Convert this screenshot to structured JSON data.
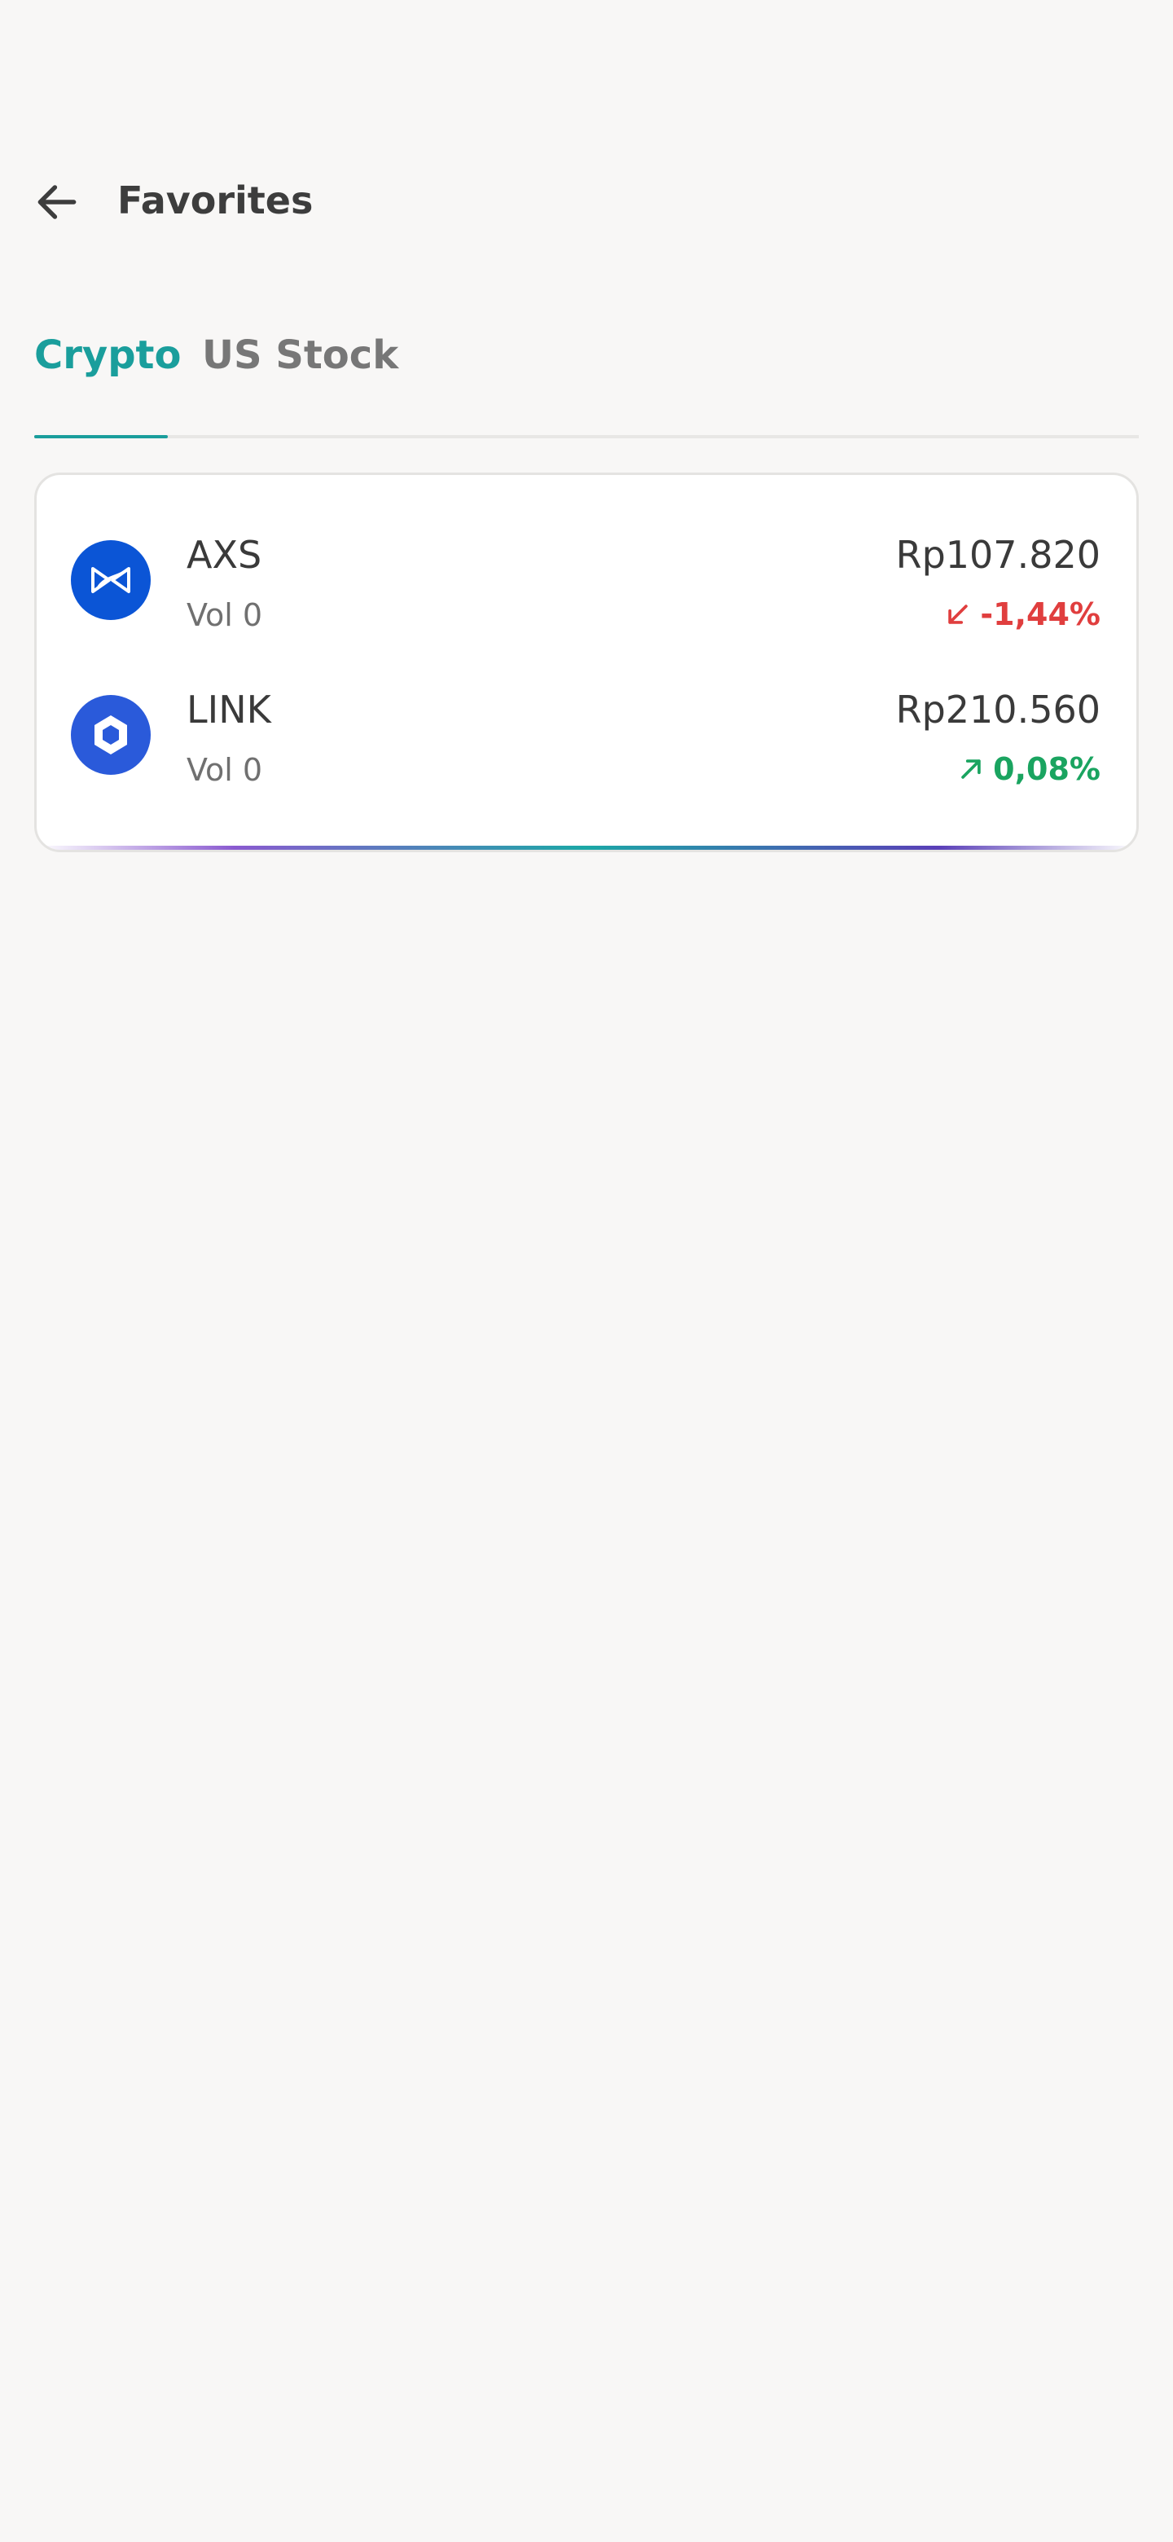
{
  "header": {
    "title": "Favorites",
    "back_icon": "arrow-left-icon"
  },
  "tabs": [
    {
      "label": "Crypto",
      "active": true
    },
    {
      "label": "US Stock",
      "active": false
    }
  ],
  "colors": {
    "accent": "#1a9e9c",
    "negative": "#e03e3e",
    "positive": "#1aa460",
    "background": "#f8f7f6"
  },
  "favorites": [
    {
      "symbol": "AXS",
      "volume": "Vol 0",
      "price": "Rp107.820",
      "change": "-1,44%",
      "direction": "down",
      "icon": "axs-coin-icon"
    },
    {
      "symbol": "LINK",
      "volume": "Vol 0",
      "price": "Rp210.560",
      "change": "0,08%",
      "direction": "up",
      "icon": "link-coin-icon"
    }
  ]
}
